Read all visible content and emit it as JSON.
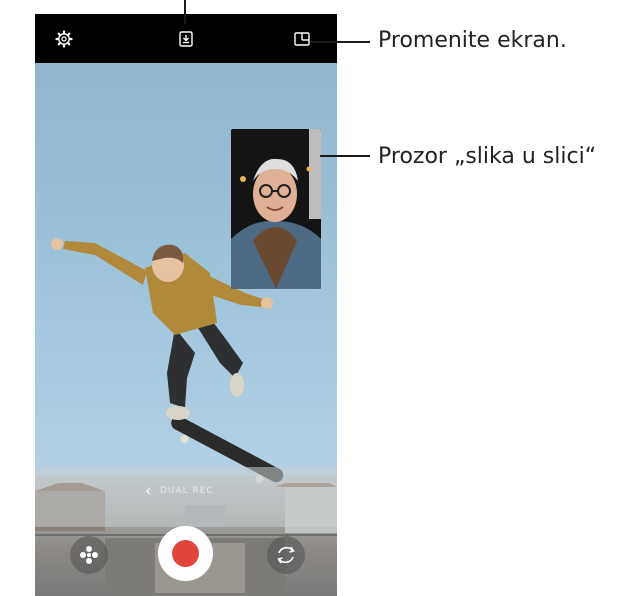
{
  "callouts": {
    "change_screen": "Promenite ekran.",
    "pip_window": "Prozor „slika u slici“"
  },
  "camera": {
    "mode_label": "DUAL REC",
    "icons": {
      "settings": "gear-icon",
      "capture": "download-icon",
      "layout": "layout-icon",
      "effects": "sparkle-icon",
      "record": "record-icon",
      "flip": "flip-camera-icon"
    },
    "colors": {
      "record": "#e0463c",
      "topbar": "#000000"
    }
  }
}
